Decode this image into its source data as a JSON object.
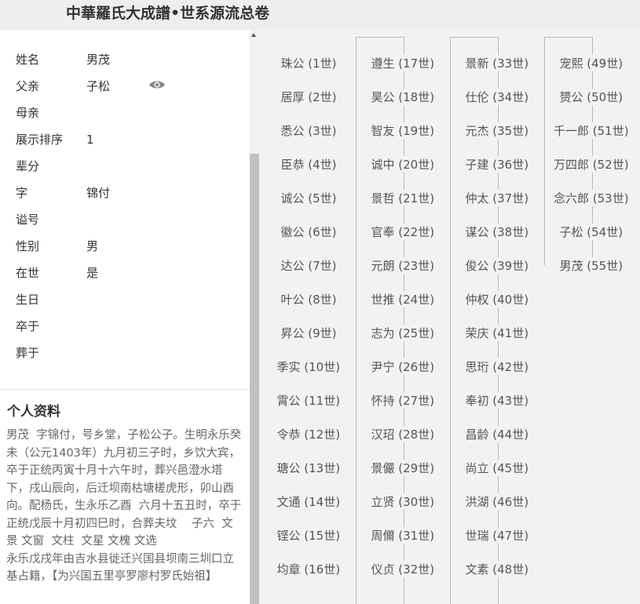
{
  "header": {
    "title": "中華羅氏大成譜•世系源流总卷"
  },
  "profile": {
    "rows": [
      {
        "label": "姓名",
        "value": "男茂"
      },
      {
        "label": "父亲",
        "value": "子松"
      },
      {
        "label": "母亲",
        "value": ""
      },
      {
        "label": "展示排序",
        "value": "1"
      },
      {
        "label": "辈分",
        "value": ""
      },
      {
        "label": "字",
        "value": "锦付"
      },
      {
        "label": "谥号",
        "value": ""
      },
      {
        "label": "性别",
        "value": "男"
      },
      {
        "label": "在世",
        "value": "是"
      },
      {
        "label": "生日",
        "value": ""
      },
      {
        "label": "卒于",
        "value": ""
      },
      {
        "label": "葬于",
        "value": ""
      }
    ]
  },
  "bio": {
    "title": "个人资料",
    "text": "男茂  字锦付，号乡堂，子松公子。生明永乐癸未（公元1403年）九月初三子时，乡饮大宾，卒于正统丙寅十月十六午时，葬兴邑澄水塔下，戌山辰向，后迁坝南枯塘槎虎形，卯山酉向。配杨氏，生永乐乙酉  六月十五丑时，卒于正统戊辰十月初四巳时，合葬夫坟    子六  文景 文窗  文柱  文星 文槐 文选\n永乐戊戌年由吉水县徙迁兴国县坝南三圳口立基占籍，【为兴国五里亭罗廖村罗氏始祖】"
  },
  "generations": {
    "columns": [
      [
        "珠公 (1世)",
        "居厚 (2世)",
        "悉公 (3世)",
        "臣恭 (4世)",
        "诚公 (5世)",
        "徽公 (6世)",
        "达公 (7世)",
        "叶公 (8世)",
        "昇公 (9世)",
        "季实 (10世)",
        "霄公 (11世)",
        "令恭 (12世)",
        "瑭公 (13世)",
        "文通 (14世)",
        "铿公 (15世)",
        "均章 (16世)"
      ],
      [
        "遵生 (17世)",
        "昊公 (18世)",
        "智友 (19世)",
        "诚中 (20世)",
        "景哲 (21世)",
        "官奉 (22世)",
        "元朗 (23世)",
        "世推 (24世)",
        "志为 (25世)",
        "尹宁 (26世)",
        "怀持 (27世)",
        "汉玿 (28世)",
        "景儼 (29世)",
        "立贤 (30世)",
        "周儞 (31世)",
        "仪贞 (32世)"
      ],
      [
        "景新 (33世)",
        "仕伦 (34世)",
        "元杰 (35世)",
        "子建 (36世)",
        "仲太 (37世)",
        "谋公 (38世)",
        "俊公 (39世)",
        "仲权 (40世)",
        "荣庆 (41世)",
        "思珩 (42世)",
        "奉初 (43世)",
        "昌龄 (44世)",
        "尚立 (45世)",
        "洪湖 (46世)",
        "世瑞 (47世)",
        "文素 (48世)"
      ],
      [
        "宠熙 (49世)",
        "赟公 (50世)",
        "千一郎 (51世)",
        "万四郎 (52世)",
        "念六郎 (53世)",
        "子松 (54世)",
        "男茂 (55世)"
      ]
    ]
  },
  "icons": {
    "eye": "eye-icon",
    "scroll_up": "scroll-up-arrow-icon"
  }
}
